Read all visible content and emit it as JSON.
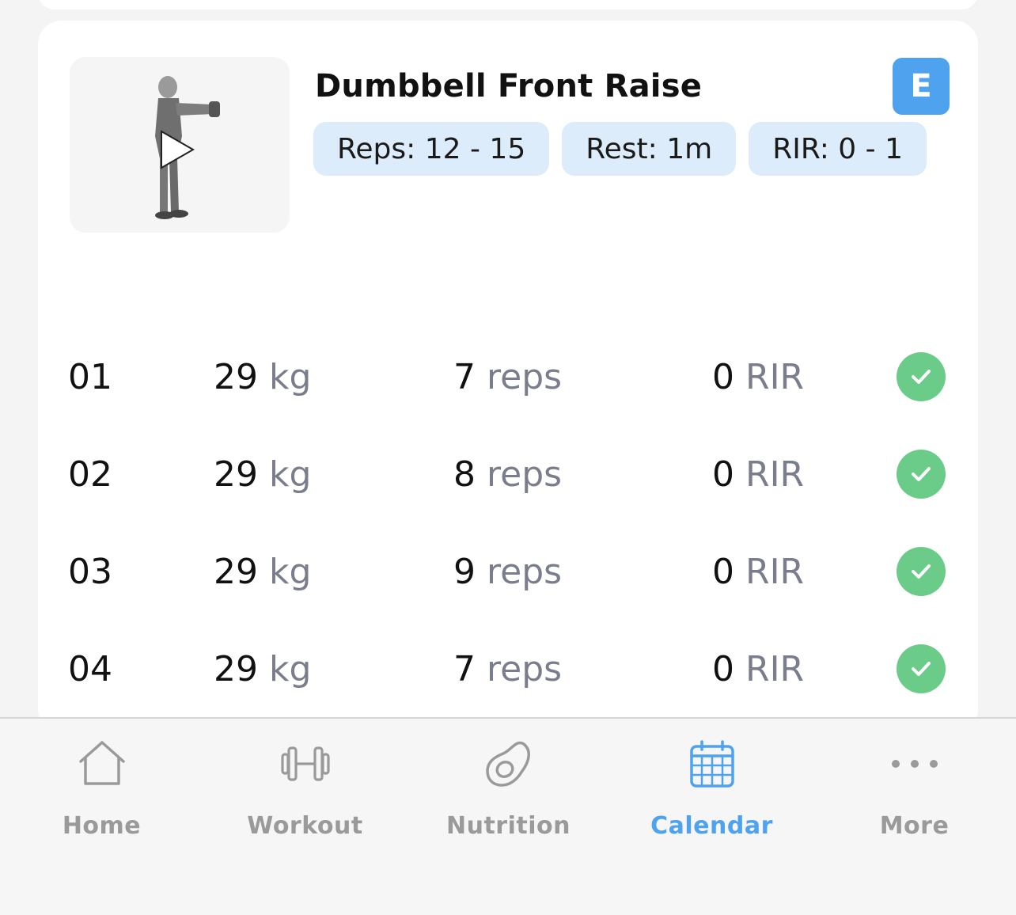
{
  "exercise": {
    "title": "Dumbbell Front Raise",
    "badge": "E",
    "chips": {
      "reps": "Reps: 12 - 15",
      "rest": "Rest: 1m",
      "rir": "RIR: 0 - 1"
    }
  },
  "sets": [
    {
      "set": "01",
      "weight": "29",
      "weight_unit": "kg",
      "reps": "7",
      "reps_unit": "reps",
      "rir": "0",
      "rir_unit": "RIR",
      "completed": true
    },
    {
      "set": "02",
      "weight": "29",
      "weight_unit": "kg",
      "reps": "8",
      "reps_unit": "reps",
      "rir": "0",
      "rir_unit": "RIR",
      "completed": true
    },
    {
      "set": "03",
      "weight": "29",
      "weight_unit": "kg",
      "reps": "9",
      "reps_unit": "reps",
      "rir": "0",
      "rir_unit": "RIR",
      "completed": true
    },
    {
      "set": "04",
      "weight": "29",
      "weight_unit": "kg",
      "reps": "7",
      "reps_unit": "reps",
      "rir": "0",
      "rir_unit": "RIR",
      "completed": true
    }
  ],
  "tabbar": {
    "home": "Home",
    "workout": "Workout",
    "nutrition": "Nutrition",
    "calendar": "Calendar",
    "more": "More",
    "active": "calendar"
  },
  "colors": {
    "accent": "#4ea2ee",
    "chip_bg": "#dcecfa",
    "check_green": "#6bcb88",
    "unit_gray": "#7a7d8c",
    "inactive_tab": "#9a9a9a"
  },
  "icons": [
    "home-icon",
    "dumbbell-icon",
    "avocado-icon",
    "calendar-icon",
    "more-dots-icon",
    "checkmark-icon",
    "play-icon"
  ]
}
